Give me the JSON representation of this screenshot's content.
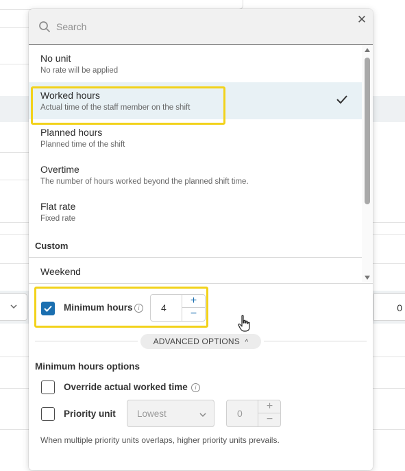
{
  "background": {
    "right_field_value": "0"
  },
  "search": {
    "placeholder": "Search",
    "close_icon": "close-icon",
    "search_icon": "search-icon"
  },
  "units": [
    {
      "title": "No unit",
      "desc": "No rate will be applied",
      "selected": false
    },
    {
      "title": "Worked hours",
      "desc": "Actual time of the staff member on the shift",
      "selected": true
    },
    {
      "title": "Planned hours",
      "desc": "Planned time of the shift",
      "selected": false
    },
    {
      "title": "Overtime",
      "desc": "The number of hours worked beyond the planned shift time.",
      "selected": false
    },
    {
      "title": "Flat rate",
      "desc": "Fixed rate",
      "selected": false
    }
  ],
  "custom_group": {
    "label": "Custom",
    "items": [
      "Weekend"
    ]
  },
  "minimum_hours": {
    "label": "Minimum hours",
    "checked": true,
    "value": "4",
    "plus": "+",
    "minus": "−"
  },
  "advanced": {
    "label": "ADVANCED OPTIONS",
    "chevron": "^"
  },
  "options": {
    "title": "Minimum hours options",
    "override_label": "Override actual worked time",
    "override_checked": false,
    "priority_label": "Priority unit",
    "priority_checked": false,
    "priority_select": "Lowest",
    "priority_value": "0",
    "plus": "+",
    "minus": "−",
    "note": "When multiple priority units overlaps, higher priority units prevails."
  },
  "colors": {
    "accent": "#1b6fb0",
    "highlight": "#f2d21b",
    "selected_bg": "#e8f1f5"
  }
}
